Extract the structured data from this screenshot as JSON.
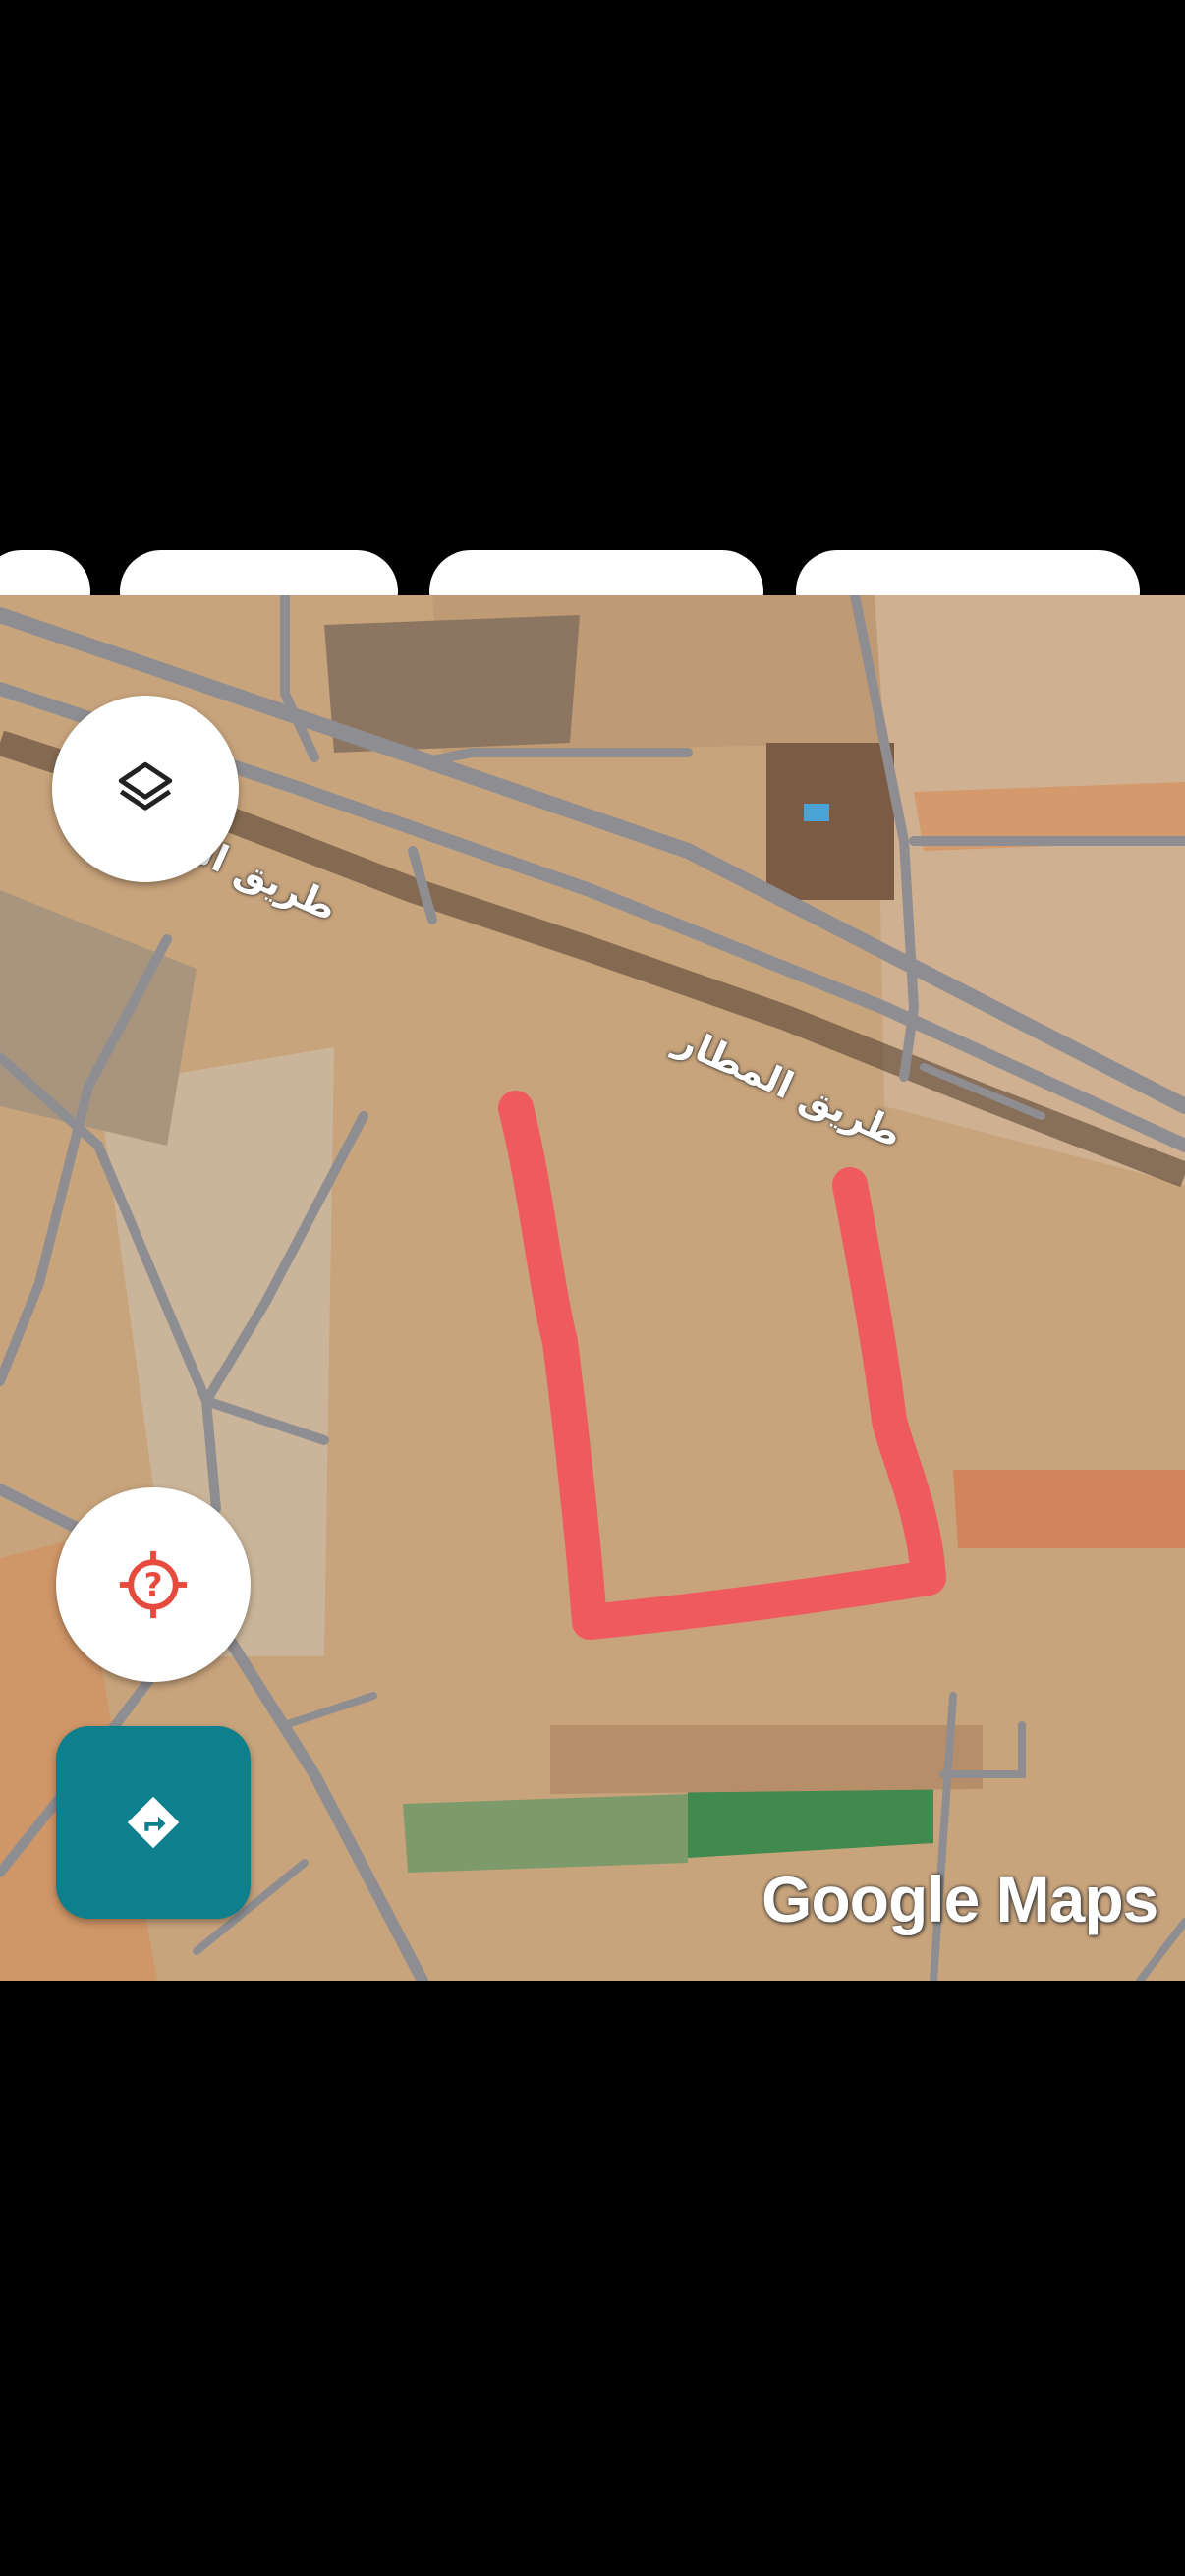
{
  "map": {
    "attribution": "Google Maps",
    "road_labels": [
      "طريق المطار",
      "طريق المـ"
    ],
    "marked_area_color": "#ef5a5f",
    "road_color": "#8e8e92",
    "directions_color": "#0e7f8c",
    "locate_icon_color": "#e64a3c"
  },
  "controls": {
    "layers_icon": "layers-icon",
    "locate_icon": "target-question-icon",
    "directions_icon": "directions-turn-icon"
  }
}
